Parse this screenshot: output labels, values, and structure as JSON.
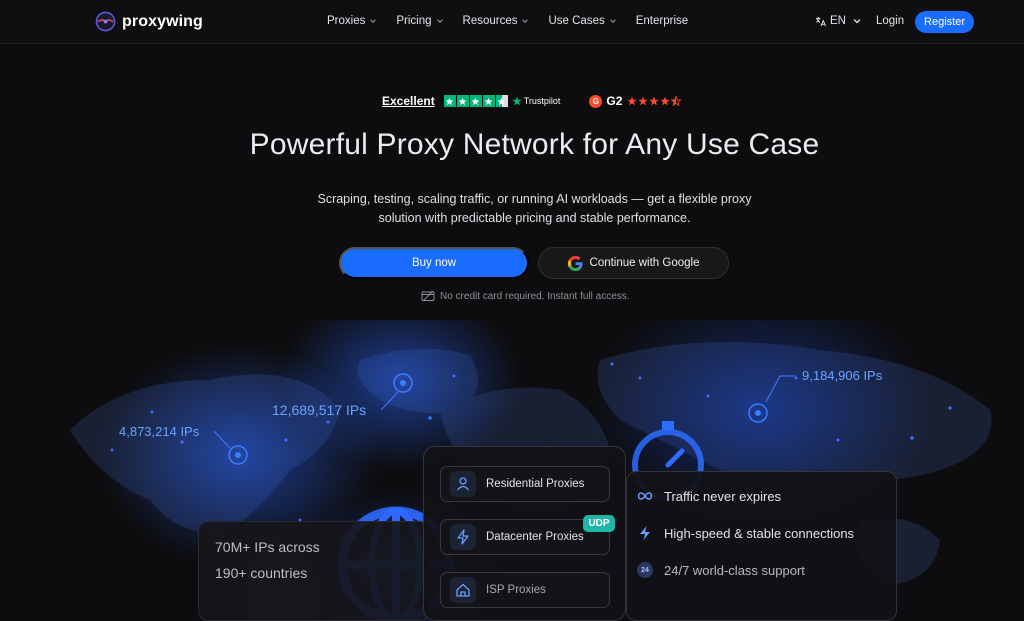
{
  "brand": {
    "name": "proxywing"
  },
  "nav": {
    "items": [
      {
        "label": "Proxies",
        "has_dropdown": true
      },
      {
        "label": "Pricing",
        "has_dropdown": true
      },
      {
        "label": "Resources",
        "has_dropdown": true
      },
      {
        "label": "Use Cases",
        "has_dropdown": true
      },
      {
        "label": "Enterprise",
        "has_dropdown": false
      }
    ],
    "language": "EN",
    "login": "Login",
    "register": "Register"
  },
  "ratings": {
    "trustpilot_label": "Excellent",
    "trustpilot_brand": "Trustpilot",
    "trustpilot_stars": 4.5,
    "g2_label": "G2",
    "g2_stars": 4.5
  },
  "hero": {
    "title": "Powerful Proxy Network for Any Use Case",
    "subtitle_line1": "Scraping, testing, scaling traffic, or running AI workloads — get a flexible proxy",
    "subtitle_line2": "solution with predictable pricing and stable performance.",
    "buy_button": "Buy now",
    "google_button": "Continue with Google",
    "note": "No credit card required. Instant full access."
  },
  "map_labels": {
    "americas": "4,873,214 IPs",
    "europe": "12,689,517 IPs",
    "asia": "9,184,906 IPs"
  },
  "stats": {
    "line1": "70M+ IPs across",
    "line2": "190+ countries"
  },
  "products": {
    "items": [
      {
        "label": "Residential Proxies",
        "icon": "user-icon"
      },
      {
        "label": "Datacenter Proxies",
        "icon": "bolt-icon",
        "badge": "UDP"
      },
      {
        "label": "ISP Proxies",
        "icon": "home-icon"
      }
    ]
  },
  "features": {
    "items": [
      {
        "label": "Traffic never expires",
        "icon": "infinity-icon"
      },
      {
        "label": "High-speed & stable connections",
        "icon": "lightning-icon"
      },
      {
        "label": "24/7 world-class support",
        "icon": "support-24-icon",
        "icon_text": "24"
      }
    ]
  },
  "colors": {
    "accent": "#1a6cff",
    "trustpilot": "#00b67a",
    "g2": "#ff492c",
    "udp_badge": "#1fb6a8",
    "map_glow": "#1f5cff"
  }
}
